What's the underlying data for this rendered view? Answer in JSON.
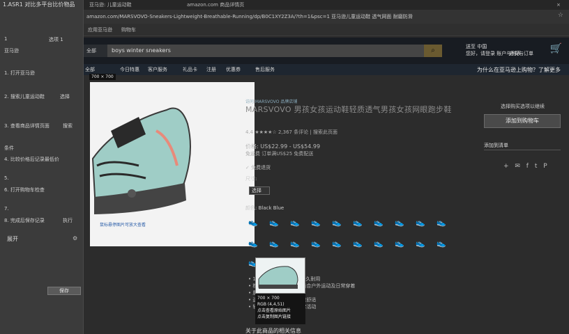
{
  "left_panel": {
    "title": "1.ASR1 对比多平台比价物品",
    "items": [
      {
        "label": "1",
        "sub": "选项 1"
      },
      {
        "label": "亚马逊",
        "sub": ""
      },
      {
        "label": "1. 打开亚马逊",
        "sub": ""
      },
      {
        "label": "2. 搜索儿童运动鞋",
        "sub": "选择"
      },
      {
        "label": "3. 查看商品详情页面",
        "sub": "搜索"
      },
      {
        "label": "条件",
        "sub": ""
      },
      {
        "label": "4. 比较价格后记录最低价",
        "sub": ""
      },
      {
        "label": "5.",
        "sub": ""
      },
      {
        "label": "6. 打开购物车检查",
        "sub": ""
      },
      {
        "label": "7.",
        "sub": ""
      },
      {
        "label": "8. 完成后保存记录",
        "sub": "执行"
      }
    ],
    "expand_label": "展开",
    "button_label": "保存"
  },
  "browser": {
    "tabs": [
      "亚马逊: 儿童运动鞋",
      "amazon.com 商品详情页",
      "×"
    ],
    "address": "amazon.com/MARSVOVO-Sneakers-Lightweight-Breathable-Running/dp/B0C1XY2Z3A/?th=1&psc=1 亚马逊儿童运动鞋 透气网面 耐磨防滑",
    "bookmarks": [
      "应用",
      "亚马逊",
      "购物车"
    ]
  },
  "amazon": {
    "search_category": "全部",
    "search_value": "boys winter sneakers",
    "deliver": "送至 中国",
    "account": "您好，请登录\n账户与列表",
    "orders": "退货与订单",
    "nav_items": [
      "全部",
      "今日特惠",
      "客户服务",
      "礼品卡",
      "注册",
      "优惠券",
      "售后服务"
    ],
    "nav_promo": "为什么在亚马逊上购物？了解更多"
  },
  "product": {
    "image_dims": "700 × 700",
    "zoom_hint": "鼠标悬停图片可放大查看",
    "brand": "访问 MARSVOVO 品牌店铺",
    "title": "MARSVOVO 男孩女孩运动鞋轻质透气男孩女孩网眼跑步鞋",
    "rating": "4.4 ★★★★☆  2,367 条评论  |  搜索此页面",
    "price": "价格: US$22.99 - US$54.99",
    "price_sub": "免运费 订单满US$25 免费配送",
    "prime": "✓ 免费退货",
    "size_label": "尺寸:",
    "size_value": "选择",
    "color_label": "颜色: Black Blue",
    "bullets": [
      "• 100%合成材料制成，经久耐用",
      "• 橡胶鞋底，防滑耐磨，适合户外运动及日常穿着",
      "• 魔术贴设计，方便穿脱",
      "• 透气网面，保持脚部干爽舒适",
      "• 轻质设计，适合儿童日常活动"
    ],
    "footer_heading": "关于此商品的相关信息",
    "popup_dims": "700 × 700",
    "popup_rgb": "RGB (4,4,51)",
    "popup_actions": [
      "点击查看原始图片",
      "点击复制图片链接"
    ]
  },
  "buybox": {
    "top_text": "选择购买选项以继续",
    "cart_button": "添加到购物车",
    "list_button": "添加到清单",
    "share_icons": "+ ✉ f t P"
  }
}
